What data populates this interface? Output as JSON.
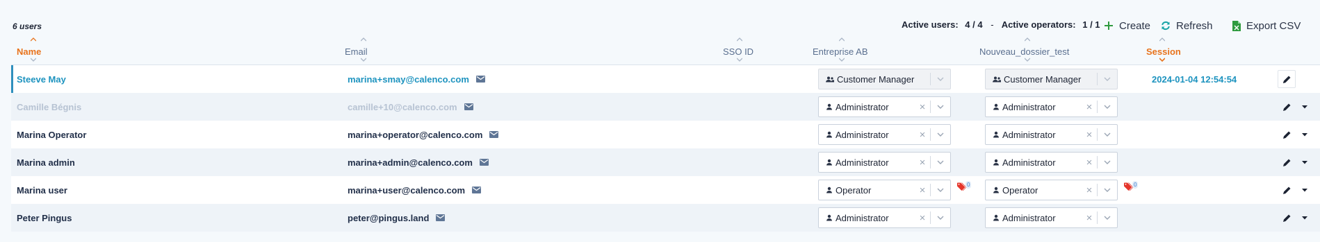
{
  "toolbar": {
    "user_count": "6 users",
    "active_users_label": "Active users:",
    "active_users_value": "4 / 4",
    "separator": "-",
    "active_operators_label": "Active operators:",
    "active_operators_value": "1 / 1",
    "create_label": "Create",
    "refresh_label": "Refresh",
    "export_label": "Export CSV"
  },
  "columns": {
    "name": "Name",
    "email": "Email",
    "sso": "SSO ID",
    "org1": "Entreprise AB",
    "org2": "Nouveau_dossier_test",
    "session": "Session"
  },
  "rows": [
    {
      "name": "Steeve May",
      "email": "marina+smay@calenco.com",
      "role1": "Customer Manager",
      "role2": "Customer Manager",
      "session": "2024-01-04 12:54:54"
    },
    {
      "name": "Camille Bégnis",
      "email": "camille+10@calenco.com",
      "role1": "Administrator",
      "role2": "Administrator",
      "session": ""
    },
    {
      "name": "Marina Operator",
      "email": "marina+operator@calenco.com",
      "role1": "Administrator",
      "role2": "Administrator",
      "session": ""
    },
    {
      "name": "Marina admin",
      "email": "marina+admin@calenco.com",
      "role1": "Administrator",
      "role2": "Administrator",
      "session": ""
    },
    {
      "name": "Marina user",
      "email": "marina+user@calenco.com",
      "role1": "Operator",
      "role2": "Operator",
      "tag_count1": "0",
      "tag_count2": "0",
      "session": ""
    },
    {
      "name": "Peter Pingus",
      "email": "peter@pingus.land",
      "role1": "Administrator",
      "role2": "Administrator",
      "session": ""
    }
  ],
  "icons": {
    "create": "plus-icon",
    "refresh": "refresh-icon",
    "export": "csv-file-icon",
    "email": "envelope-icon",
    "edit": "pencil-icon",
    "clear": "close-icon",
    "dropdown": "chevron-down-icon",
    "role": "user-icon",
    "tags": "tags-icon"
  },
  "colors": {
    "accent_sort": "#e8731c",
    "link": "#1d93bf",
    "disabled_text": "#b7c3d3",
    "create_icon": "#2e9a3e",
    "refresh_icon": "#18a3a6",
    "export_icon": "#2e9a3e",
    "tag_icon": "#e5352b"
  }
}
